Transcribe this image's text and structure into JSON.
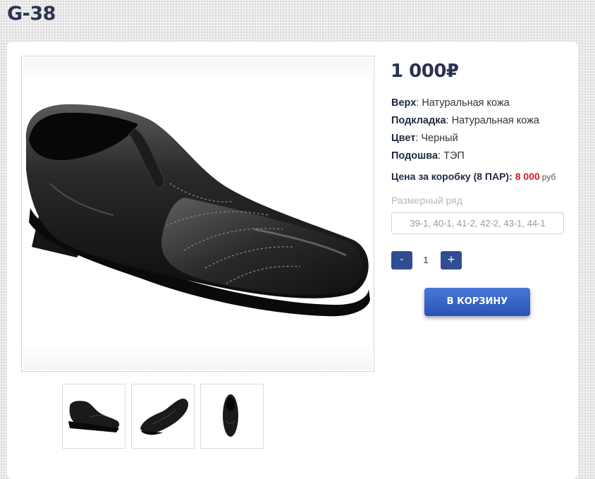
{
  "product": {
    "title": "G-38",
    "price": "1 000₽",
    "specs": [
      {
        "label": "Верх",
        "value": ": Натуральная кожа"
      },
      {
        "label": "Подкладка",
        "value": ": Натуральная кожа"
      },
      {
        "label": "Цвет",
        "value": ": Черный"
      },
      {
        "label": "Подошва",
        "value": ": ТЭП"
      }
    ],
    "box_price": {
      "label": "Цена за коробку (8 ПАР):",
      "value": "8 000",
      "unit": "руб"
    },
    "size_range": {
      "label": "Размерный ряд",
      "value": "39-1, 40-1, 41-2, 42-2, 43-1, 44-1"
    },
    "quantity": {
      "minus_label": "-",
      "value": "1",
      "plus_label": "+"
    },
    "cart_button_label": "В КОРЗИНУ",
    "colors": {
      "accent_blue": "#2f4d93",
      "cart_button": "#3563c7",
      "price_red": "#cc1e2a",
      "title_navy": "#2b3350"
    }
  }
}
